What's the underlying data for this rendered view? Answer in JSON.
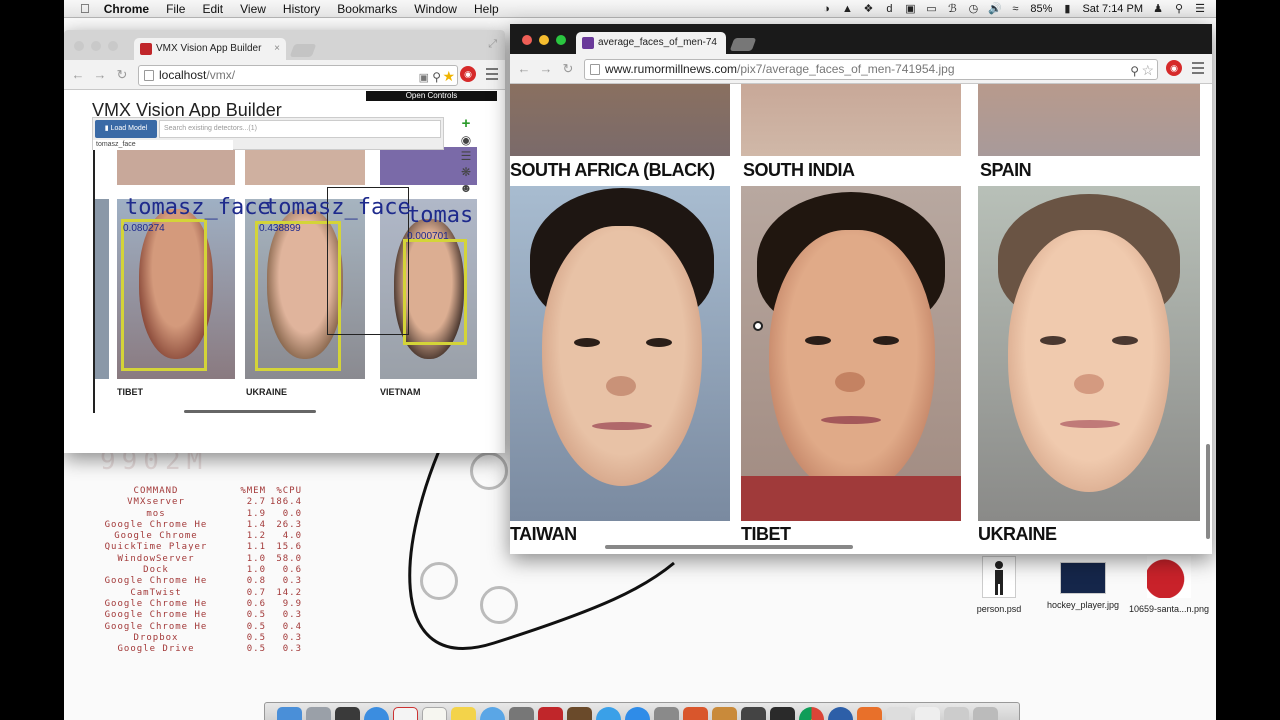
{
  "menubar": {
    "app_name": "Chrome",
    "items": [
      "File",
      "Edit",
      "View",
      "History",
      "Bookmarks",
      "Window",
      "Help"
    ],
    "battery": "85%",
    "clock": "Sat 7:14 PM"
  },
  "left_window": {
    "tab_title": "VMX Vision App Builder",
    "url_host": "localhost",
    "url_path": "/vmx/",
    "page_title": "VMX Vision App Builder",
    "open_controls": "Open Controls",
    "load_model": "Load Model",
    "search_placeholder": "Search existing detectors...(1)",
    "dropdown_item": "tomasz_face",
    "labels": [
      "TIBET",
      "UKRAINE",
      "VIETNAM"
    ],
    "detections": [
      {
        "name": "tomasz_face",
        "score": "0.080274"
      },
      {
        "name": "tomasz_face",
        "score": "0.438899"
      },
      {
        "name": "tomas",
        "score": "0.000701"
      }
    ]
  },
  "right_window": {
    "tab_title": "average_faces_of_men-74",
    "url_host": "www.rumormillnews.com",
    "url_path": "/pix7/average_faces_of_men-741954.jpg",
    "top_labels": [
      "SOUTH AFRICA (BLACK)",
      "SOUTH INDIA",
      "SPAIN"
    ],
    "bottom_labels": [
      "TAIWAN",
      "TIBET",
      "UKRAINE"
    ]
  },
  "process_list": {
    "headers": [
      "COMMAND",
      "%MEM",
      "%CPU"
    ],
    "rows": [
      [
        "VMXserver",
        "2.7",
        "186.4"
      ],
      [
        "mos",
        "1.9",
        "0.0"
      ],
      [
        "Google Chrome He",
        "1.4",
        "26.3"
      ],
      [
        "Google Chrome",
        "1.2",
        "4.0"
      ],
      [
        "QuickTime Player",
        "1.1",
        "15.6"
      ],
      [
        "WindowServer",
        "1.0",
        "58.0"
      ],
      [
        "Dock",
        "1.0",
        "0.6"
      ],
      [
        "Google Chrome He",
        "0.8",
        "0.3"
      ],
      [
        "CamTwist",
        "0.7",
        "14.2"
      ],
      [
        "Google Chrome He",
        "0.6",
        "9.9"
      ],
      [
        "Google Chrome He",
        "0.5",
        "0.3"
      ],
      [
        "Google Chrome He",
        "0.5",
        "0.4"
      ],
      [
        "Dropbox",
        "0.5",
        "0.3"
      ],
      [
        "Google Drive",
        "0.5",
        "0.3"
      ]
    ]
  },
  "desktop_icons": [
    {
      "label": "person.psd"
    },
    {
      "label": "hockey_player.jpg"
    },
    {
      "label": "10659-santa...n.png"
    }
  ]
}
